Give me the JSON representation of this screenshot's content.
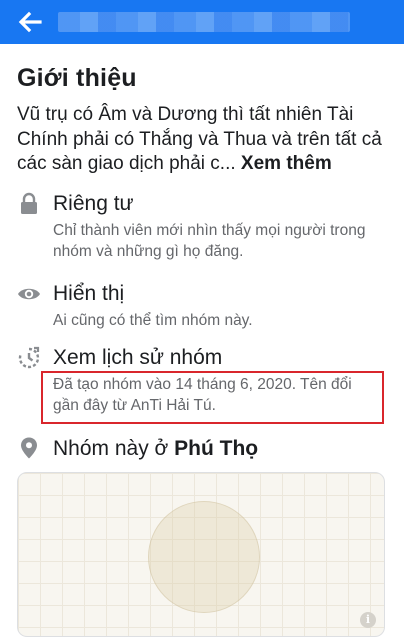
{
  "header": {
    "back_icon": "arrow-left-icon",
    "color": "#1877f2"
  },
  "about": {
    "title": "Giới thiệu",
    "description": "Vũ trụ có Âm và Dương thì tất nhiên Tài Chính phải có Thắng và Thua và trên tất cả các sàn giao dịch phải c... ",
    "see_more": "Xem thêm"
  },
  "privacy": {
    "icon": "lock-icon",
    "title": "Riêng tư",
    "subtitle": "Chỉ thành viên mới nhìn thấy mọi người trong nhóm và những gì họ đăng."
  },
  "visibility": {
    "icon": "eye-icon",
    "title": "Hiển thị",
    "subtitle": "Ai cũng có thể tìm nhóm này."
  },
  "history": {
    "icon": "history-icon",
    "title": "Xem lịch sử nhóm",
    "subtitle": "Đã tạo nhóm vào 14 tháng 6, 2020. Tên đổi gần đây từ AnTi Hải Tú.",
    "highlight_color": "#d9262c"
  },
  "location": {
    "icon": "location-pin-icon",
    "prefix": "Nhóm này ở ",
    "place": "Phú Thọ"
  },
  "map": {
    "info_icon": "info-icon",
    "info_glyph": "i"
  }
}
